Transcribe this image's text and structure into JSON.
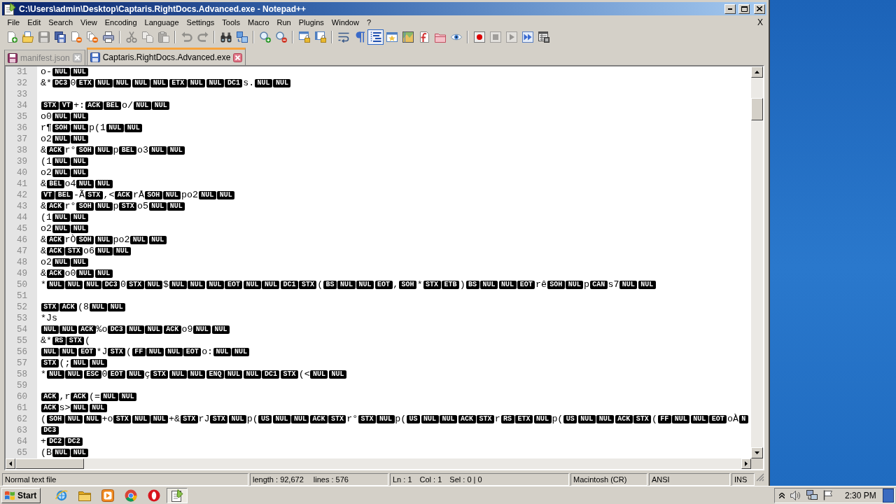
{
  "window": {
    "title": "C:\\Users\\admin\\Desktop\\Captaris.RightDocs.Advanced.exe - Notepad++"
  },
  "menu_bar": {
    "items": [
      "File",
      "Edit",
      "Search",
      "View",
      "Encoding",
      "Language",
      "Settings",
      "Tools",
      "Macro",
      "Run",
      "Plugins",
      "Window",
      "?"
    ],
    "close_document": "X"
  },
  "toolbar": [
    {
      "pressed": false,
      "disabled": false
    },
    {
      "pressed": false,
      "disabled": false
    },
    {
      "pressed": false,
      "disabled": true
    },
    {
      "pressed": false,
      "disabled": false
    },
    {
      "pressed": false,
      "disabled": false
    },
    {
      "pressed": false,
      "disabled": false
    },
    {
      "pressed": false,
      "disabled": false
    },
    {
      "pressed": false,
      "disabled": true
    },
    {
      "pressed": false,
      "disabled": true
    },
    {
      "pressed": false,
      "disabled": true
    },
    {
      "pressed": false,
      "disabled": true
    },
    {
      "pressed": false,
      "disabled": true
    },
    {
      "pressed": false,
      "disabled": false
    },
    {
      "pressed": false,
      "disabled": false
    },
    {
      "pressed": false,
      "disabled": false
    },
    {
      "pressed": false,
      "disabled": false
    },
    {
      "pressed": false,
      "disabled": false
    },
    {
      "pressed": false,
      "disabled": false
    },
    {
      "pressed": false,
      "disabled": false
    },
    {
      "pressed": false,
      "disabled": false
    },
    {
      "pressed": true,
      "disabled": false
    },
    {
      "pressed": false,
      "disabled": false
    },
    {
      "pressed": false,
      "disabled": false
    },
    {
      "pressed": false,
      "disabled": false
    },
    {
      "pressed": false,
      "disabled": false
    },
    {
      "pressed": false,
      "disabled": false
    },
    {
      "pressed": false,
      "disabled": false
    },
    {
      "pressed": false,
      "disabled": true
    },
    {
      "pressed": false,
      "disabled": true
    },
    {
      "pressed": false,
      "disabled": false
    },
    {
      "pressed": false,
      "disabled": false
    }
  ],
  "tabs": [
    {
      "label": "manifest.json",
      "selected": false,
      "modified": true
    },
    {
      "label": "Captaris.RightDocs.Advanced.exe",
      "selected": true,
      "modified": false
    }
  ],
  "editor": {
    "lines": [
      {
        "number": "31",
        "segments": [
          {
            "kind": "text",
            "text": "o-"
          },
          {
            "kind": "control",
            "text": "NUL"
          },
          {
            "kind": "control",
            "text": "NUL"
          }
        ]
      },
      {
        "number": "32",
        "segments": [
          {
            "kind": "text",
            "text": "&*"
          },
          {
            "kind": "control",
            "text": "DC3"
          },
          {
            "kind": "text",
            "text": "0"
          },
          {
            "kind": "control",
            "text": "ETX"
          },
          {
            "kind": "control",
            "text": "NUL"
          },
          {
            "kind": "control",
            "text": "NUL"
          },
          {
            "kind": "control",
            "text": "NUL"
          },
          {
            "kind": "control",
            "text": "NUL"
          },
          {
            "kind": "control",
            "text": "ETX"
          },
          {
            "kind": "control",
            "text": "NUL"
          },
          {
            "kind": "control",
            "text": "NUL"
          },
          {
            "kind": "control",
            "text": "DC1"
          },
          {
            "kind": "text",
            "text": "s."
          },
          {
            "kind": "control",
            "text": "NUL"
          },
          {
            "kind": "control",
            "text": "NUL"
          }
        ]
      },
      {
        "number": "33"
      },
      {
        "number": "34",
        "segments": [
          {
            "kind": "control",
            "text": "STX"
          },
          {
            "kind": "control",
            "text": "VT"
          },
          {
            "kind": "text",
            "text": "+:"
          },
          {
            "kind": "control",
            "text": "ACK"
          },
          {
            "kind": "control",
            "text": "BEL"
          },
          {
            "kind": "text",
            "text": "o/"
          },
          {
            "kind": "control",
            "text": "NUL"
          },
          {
            "kind": "control",
            "text": "NUL"
          }
        ]
      },
      {
        "number": "35",
        "segments": [
          {
            "kind": "text",
            "text": "o0"
          },
          {
            "kind": "control",
            "text": "NUL"
          },
          {
            "kind": "control",
            "text": "NUL"
          }
        ]
      },
      {
        "number": "36",
        "segments": [
          {
            "kind": "text",
            "text": "r¶"
          },
          {
            "kind": "control",
            "text": "SOH"
          },
          {
            "kind": "control",
            "text": "NUL"
          },
          {
            "kind": "text",
            "text": "p(1"
          },
          {
            "kind": "control",
            "text": "NUL"
          },
          {
            "kind": "control",
            "text": "NUL"
          }
        ]
      },
      {
        "number": "37",
        "segments": [
          {
            "kind": "text",
            "text": "o2"
          },
          {
            "kind": "control",
            "text": "NUL"
          },
          {
            "kind": "control",
            "text": "NUL"
          }
        ]
      },
      {
        "number": "38",
        "segments": [
          {
            "kind": "text",
            "text": "&"
          },
          {
            "kind": "control",
            "text": "ACK"
          },
          {
            "kind": "text",
            "text": "r°"
          },
          {
            "kind": "control",
            "text": "SOH"
          },
          {
            "kind": "control",
            "text": "NUL"
          },
          {
            "kind": "text",
            "text": "p"
          },
          {
            "kind": "control",
            "text": "BEL"
          },
          {
            "kind": "text",
            "text": "o3"
          },
          {
            "kind": "control",
            "text": "NUL"
          },
          {
            "kind": "control",
            "text": "NUL"
          }
        ]
      },
      {
        "number": "39",
        "segments": [
          {
            "kind": "text",
            "text": "(1"
          },
          {
            "kind": "control",
            "text": "NUL"
          },
          {
            "kind": "control",
            "text": "NUL"
          }
        ]
      },
      {
        "number": "40",
        "segments": [
          {
            "kind": "text",
            "text": "o2"
          },
          {
            "kind": "control",
            "text": "NUL"
          },
          {
            "kind": "control",
            "text": "NUL"
          }
        ]
      },
      {
        "number": "41",
        "segments": [
          {
            "kind": "text",
            "text": "&"
          },
          {
            "kind": "control",
            "text": "BEL"
          },
          {
            "kind": "text",
            "text": "o4"
          },
          {
            "kind": "control",
            "text": "NUL"
          },
          {
            "kind": "control",
            "text": "NUL"
          }
        ]
      },
      {
        "number": "42",
        "segments": [
          {
            "kind": "control",
            "text": "VT"
          },
          {
            "kind": "control",
            "text": "BEL"
          },
          {
            "kind": "text",
            "text": "-Ã"
          },
          {
            "kind": "control",
            "text": "STX"
          },
          {
            "kind": "text",
            "text": ",<"
          },
          {
            "kind": "control",
            "text": "ACK"
          },
          {
            "kind": "text",
            "text": "rÅ"
          },
          {
            "kind": "control",
            "text": "SOH"
          },
          {
            "kind": "control",
            "text": "NUL"
          },
          {
            "kind": "text",
            "text": "po2"
          },
          {
            "kind": "control",
            "text": "NUL"
          },
          {
            "kind": "control",
            "text": "NUL"
          }
        ]
      },
      {
        "number": "43",
        "segments": [
          {
            "kind": "text",
            "text": "&"
          },
          {
            "kind": "control",
            "text": "ACK"
          },
          {
            "kind": "text",
            "text": "r°"
          },
          {
            "kind": "control",
            "text": "SOH"
          },
          {
            "kind": "control",
            "text": "NUL"
          },
          {
            "kind": "text",
            "text": "p"
          },
          {
            "kind": "control",
            "text": "STX"
          },
          {
            "kind": "text",
            "text": "o5"
          },
          {
            "kind": "control",
            "text": "NUL"
          },
          {
            "kind": "control",
            "text": "NUL"
          }
        ]
      },
      {
        "number": "44",
        "segments": [
          {
            "kind": "text",
            "text": "(1"
          },
          {
            "kind": "control",
            "text": "NUL"
          },
          {
            "kind": "control",
            "text": "NUL"
          }
        ]
      },
      {
        "number": "45",
        "segments": [
          {
            "kind": "text",
            "text": "o2"
          },
          {
            "kind": "control",
            "text": "NUL"
          },
          {
            "kind": "control",
            "text": "NUL"
          }
        ]
      },
      {
        "number": "46",
        "segments": [
          {
            "kind": "text",
            "text": "&"
          },
          {
            "kind": "control",
            "text": "ACK"
          },
          {
            "kind": "text",
            "text": "rÒ"
          },
          {
            "kind": "control",
            "text": "SOH"
          },
          {
            "kind": "control",
            "text": "NUL"
          },
          {
            "kind": "text",
            "text": "po2"
          },
          {
            "kind": "control",
            "text": "NUL"
          },
          {
            "kind": "control",
            "text": "NUL"
          }
        ]
      },
      {
        "number": "47",
        "segments": [
          {
            "kind": "text",
            "text": "&"
          },
          {
            "kind": "control",
            "text": "ACK"
          },
          {
            "kind": "control",
            "text": "STX"
          },
          {
            "kind": "text",
            "text": "o6"
          },
          {
            "kind": "control",
            "text": "NUL"
          },
          {
            "kind": "control",
            "text": "NUL"
          }
        ]
      },
      {
        "number": "48",
        "segments": [
          {
            "kind": "text",
            "text": "o2"
          },
          {
            "kind": "control",
            "text": "NUL"
          },
          {
            "kind": "control",
            "text": "NUL"
          }
        ]
      },
      {
        "number": "49",
        "segments": [
          {
            "kind": "text",
            "text": "&"
          },
          {
            "kind": "control",
            "text": "ACK"
          },
          {
            "kind": "text",
            "text": "o0"
          },
          {
            "kind": "control",
            "text": "NUL"
          },
          {
            "kind": "control",
            "text": "NUL"
          }
        ]
      },
      {
        "number": "50",
        "segments": [
          {
            "kind": "text",
            "text": "*"
          },
          {
            "kind": "control",
            "text": "NUL"
          },
          {
            "kind": "control",
            "text": "NUL"
          },
          {
            "kind": "control",
            "text": "NUL"
          },
          {
            "kind": "control",
            "text": "DC3"
          },
          {
            "kind": "text",
            "text": "0"
          },
          {
            "kind": "control",
            "text": "STX"
          },
          {
            "kind": "control",
            "text": "NUL"
          },
          {
            "kind": "text",
            "text": "$"
          },
          {
            "kind": "control",
            "text": "NUL"
          },
          {
            "kind": "control",
            "text": "NUL"
          },
          {
            "kind": "control",
            "text": "NUL"
          },
          {
            "kind": "control",
            "text": "EOT"
          },
          {
            "kind": "control",
            "text": "NUL"
          },
          {
            "kind": "control",
            "text": "NUL"
          },
          {
            "kind": "control",
            "text": "DC1"
          },
          {
            "kind": "control",
            "text": "STX"
          },
          {
            "kind": "text",
            "text": "("
          },
          {
            "kind": "control",
            "text": "BS"
          },
          {
            "kind": "control",
            "text": "NUL"
          },
          {
            "kind": "control",
            "text": "NUL"
          },
          {
            "kind": "control",
            "text": "EOT"
          },
          {
            "kind": "text",
            "text": ","
          },
          {
            "kind": "control",
            "text": "SOH"
          },
          {
            "kind": "text",
            "text": "*"
          },
          {
            "kind": "control",
            "text": "STX"
          },
          {
            "kind": "control",
            "text": "ETB"
          },
          {
            "kind": "text",
            "text": ")"
          },
          {
            "kind": "control",
            "text": "BS"
          },
          {
            "kind": "control",
            "text": "NUL"
          },
          {
            "kind": "control",
            "text": "NUL"
          },
          {
            "kind": "control",
            "text": "EOT"
          },
          {
            "kind": "text",
            "text": "rê"
          },
          {
            "kind": "control",
            "text": "SOH"
          },
          {
            "kind": "control",
            "text": "NUL"
          },
          {
            "kind": "text",
            "text": "p"
          },
          {
            "kind": "control",
            "text": "CAN"
          },
          {
            "kind": "text",
            "text": "s7"
          },
          {
            "kind": "control",
            "text": "NUL"
          },
          {
            "kind": "control",
            "text": "NUL"
          }
        ]
      },
      {
        "number": "51"
      },
      {
        "number": "52",
        "segments": [
          {
            "kind": "control",
            "text": "STX"
          },
          {
            "kind": "control",
            "text": "ACK"
          },
          {
            "kind": "text",
            "text": "(8"
          },
          {
            "kind": "control",
            "text": "NUL"
          },
          {
            "kind": "control",
            "text": "NUL"
          }
        ]
      },
      {
        "number": "53",
        "segments": [
          {
            "kind": "text",
            "text": "*Js"
          }
        ]
      },
      {
        "number": "54",
        "segments": [
          {
            "kind": "control",
            "text": "NUL"
          },
          {
            "kind": "control",
            "text": "NUL"
          },
          {
            "kind": "control",
            "text": "ACK"
          },
          {
            "kind": "text",
            "text": "%o"
          },
          {
            "kind": "control",
            "text": "DC3"
          },
          {
            "kind": "control",
            "text": "NUL"
          },
          {
            "kind": "control",
            "text": "NUL"
          },
          {
            "kind": "control",
            "text": "ACK"
          },
          {
            "kind": "text",
            "text": "o9"
          },
          {
            "kind": "control",
            "text": "NUL"
          },
          {
            "kind": "control",
            "text": "NUL"
          }
        ]
      },
      {
        "number": "55",
        "segments": [
          {
            "kind": "text",
            "text": "&*"
          },
          {
            "kind": "control",
            "text": "RS"
          },
          {
            "kind": "control",
            "text": "STX"
          },
          {
            "kind": "text",
            "text": "("
          }
        ]
      },
      {
        "number": "56",
        "segments": [
          {
            "kind": "control",
            "text": "NUL"
          },
          {
            "kind": "control",
            "text": "NUL"
          },
          {
            "kind": "control",
            "text": "EOT"
          },
          {
            "kind": "text",
            "text": "*J"
          },
          {
            "kind": "control",
            "text": "STX"
          },
          {
            "kind": "text",
            "text": "("
          },
          {
            "kind": "control",
            "text": "FF"
          },
          {
            "kind": "control",
            "text": "NUL"
          },
          {
            "kind": "control",
            "text": "NUL"
          },
          {
            "kind": "control",
            "text": "EOT"
          },
          {
            "kind": "text",
            "text": "o:"
          },
          {
            "kind": "control",
            "text": "NUL"
          },
          {
            "kind": "control",
            "text": "NUL"
          }
        ]
      },
      {
        "number": "57",
        "segments": [
          {
            "kind": "control",
            "text": "STX"
          },
          {
            "kind": "text",
            "text": "(;"
          },
          {
            "kind": "control",
            "text": "NUL"
          },
          {
            "kind": "control",
            "text": "NUL"
          }
        ]
      },
      {
        "number": "58",
        "segments": [
          {
            "kind": "text",
            "text": "*"
          },
          {
            "kind": "control",
            "text": "NUL"
          },
          {
            "kind": "control",
            "text": "NUL"
          },
          {
            "kind": "control",
            "text": "ESC"
          },
          {
            "kind": "text",
            "text": "0"
          },
          {
            "kind": "control",
            "text": "EOT"
          },
          {
            "kind": "control",
            "text": "NUL"
          },
          {
            "kind": "text",
            "text": "ç"
          },
          {
            "kind": "control",
            "text": "STX"
          },
          {
            "kind": "control",
            "text": "NUL"
          },
          {
            "kind": "control",
            "text": "NUL"
          },
          {
            "kind": "control",
            "text": "ENQ"
          },
          {
            "kind": "control",
            "text": "NUL"
          },
          {
            "kind": "control",
            "text": "NUL"
          },
          {
            "kind": "control",
            "text": "DC1"
          },
          {
            "kind": "control",
            "text": "STX"
          },
          {
            "kind": "text",
            "text": "(<"
          },
          {
            "kind": "control",
            "text": "NUL"
          },
          {
            "kind": "control",
            "text": "NUL"
          }
        ]
      },
      {
        "number": "59"
      },
      {
        "number": "60",
        "segments": [
          {
            "kind": "control",
            "text": "ACK"
          },
          {
            "kind": "text",
            "text": ",r"
          },
          {
            "kind": "control",
            "text": "ACK"
          },
          {
            "kind": "text",
            "text": "(="
          },
          {
            "kind": "control",
            "text": "NUL"
          },
          {
            "kind": "control",
            "text": "NUL"
          }
        ]
      },
      {
        "number": "61",
        "segments": [
          {
            "kind": "control",
            "text": "ACK"
          },
          {
            "kind": "text",
            "text": "s>"
          },
          {
            "kind": "control",
            "text": "NUL"
          },
          {
            "kind": "control",
            "text": "NUL"
          }
        ]
      },
      {
        "number": "62",
        "segments": [
          {
            "kind": "text",
            "text": "("
          },
          {
            "kind": "control",
            "text": "SOH"
          },
          {
            "kind": "control",
            "text": "NUL"
          },
          {
            "kind": "control",
            "text": "NUL"
          },
          {
            "kind": "text",
            "text": "+o"
          },
          {
            "kind": "control",
            "text": "STX"
          },
          {
            "kind": "control",
            "text": "NUL"
          },
          {
            "kind": "control",
            "text": "NUL"
          },
          {
            "kind": "text",
            "text": "+&"
          },
          {
            "kind": "control",
            "text": "STX"
          },
          {
            "kind": "text",
            "text": "rJ"
          },
          {
            "kind": "control",
            "text": "STX"
          },
          {
            "kind": "control",
            "text": "NUL"
          },
          {
            "kind": "text",
            "text": "p("
          },
          {
            "kind": "control",
            "text": "US"
          },
          {
            "kind": "control",
            "text": "NUL"
          },
          {
            "kind": "control",
            "text": "NUL"
          },
          {
            "kind": "control",
            "text": "ACK"
          },
          {
            "kind": "control",
            "text": "STX"
          },
          {
            "kind": "text",
            "text": "r°"
          },
          {
            "kind": "control",
            "text": "STX"
          },
          {
            "kind": "control",
            "text": "NUL"
          },
          {
            "kind": "text",
            "text": "p("
          },
          {
            "kind": "control",
            "text": "US"
          },
          {
            "kind": "control",
            "text": "NUL"
          },
          {
            "kind": "control",
            "text": "NUL"
          },
          {
            "kind": "control",
            "text": "ACK"
          },
          {
            "kind": "control",
            "text": "STX"
          },
          {
            "kind": "text",
            "text": "r"
          },
          {
            "kind": "control",
            "text": "RS"
          },
          {
            "kind": "control",
            "text": "ETX"
          },
          {
            "kind": "control",
            "text": "NUL"
          },
          {
            "kind": "text",
            "text": "p("
          },
          {
            "kind": "control",
            "text": "US"
          },
          {
            "kind": "control",
            "text": "NUL"
          },
          {
            "kind": "control",
            "text": "NUL"
          },
          {
            "kind": "control",
            "text": "ACK"
          },
          {
            "kind": "control",
            "text": "STX"
          },
          {
            "kind": "text",
            "text": "("
          },
          {
            "kind": "control",
            "text": "FF"
          },
          {
            "kind": "control",
            "text": "NUL"
          },
          {
            "kind": "control",
            "text": "NUL"
          },
          {
            "kind": "control",
            "text": "EOT"
          },
          {
            "kind": "text",
            "text": "oÀ"
          },
          {
            "kind": "control",
            "text": "N"
          }
        ]
      },
      {
        "number": "63",
        "segments": [
          {
            "kind": "control",
            "text": "DC3"
          }
        ]
      },
      {
        "number": "64",
        "segments": [
          {
            "kind": "text",
            "text": "+"
          },
          {
            "kind": "control",
            "text": "DC2"
          },
          {
            "kind": "control",
            "text": "DC2"
          }
        ]
      },
      {
        "number": "65",
        "segments": [
          {
            "kind": "text",
            "text": "(B"
          },
          {
            "kind": "control",
            "text": "NUL"
          },
          {
            "kind": "control",
            "text": "NUL"
          }
        ]
      }
    ]
  },
  "status_bar": {
    "file_type": "Normal text file",
    "document": [
      "length : 92,672",
      "lines : 576"
    ],
    "position": [
      "Ln : 1",
      "Col : 1",
      "Sel : 0 | 0"
    ],
    "eol": "Macintosh (CR)",
    "encoding": "ANSI",
    "mode": "INS"
  },
  "taskbar": {
    "start": "Start",
    "apps": [
      {
        "selected": false
      },
      {
        "selected": false
      },
      {
        "selected": false
      },
      {
        "selected": false
      },
      {
        "selected": false
      },
      {
        "selected": true
      }
    ],
    "clock": "2:30 PM"
  }
}
